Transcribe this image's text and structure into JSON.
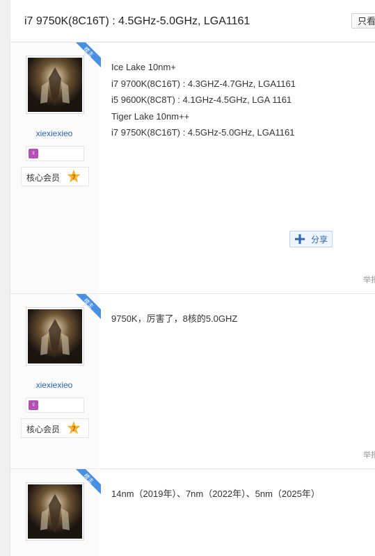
{
  "thread": {
    "title": "i7 9750K(8C16T) : 4.5GHz-5.0GHz, LGA1161",
    "only_host_label": "只看楼"
  },
  "colors": {
    "ribbon": "#4a90e2",
    "username": "#2d64b3",
    "gender_badge": "#b34fb5",
    "level_star": "#f5b22a"
  },
  "posts": [
    {
      "ribbon_label": "楼主",
      "username": "xiexiexieo",
      "gender_icon": "female-symbol-icon",
      "member_label": "核心会员",
      "level": "7",
      "lines": [
        "Ice Lake 10nm+",
        "i7 9700K(8C16T) : 4.3GHZ-4.7GHz, LGA1161",
        "i5 9600K(8C8T) : 4.1GHz-4.5GHz, LGA 1161",
        "Tiger Lake 10nm++",
        "i7 9750K(8C16T) : 4.5GHz-5.0GHz, LGA1161"
      ],
      "share_label": "分享",
      "report_label": "举报"
    },
    {
      "ribbon_label": "楼主",
      "username": "xiexiexieo",
      "gender_icon": "female-symbol-icon",
      "member_label": "核心会员",
      "level": "7",
      "lines": [
        "9750K，厉害了，8核的5.0GHZ"
      ],
      "report_label": "举报"
    },
    {
      "ribbon_label": "楼主",
      "lines": [
        "14nm（2019年）、7nm（2022年）、5nm（2025年）"
      ]
    }
  ]
}
